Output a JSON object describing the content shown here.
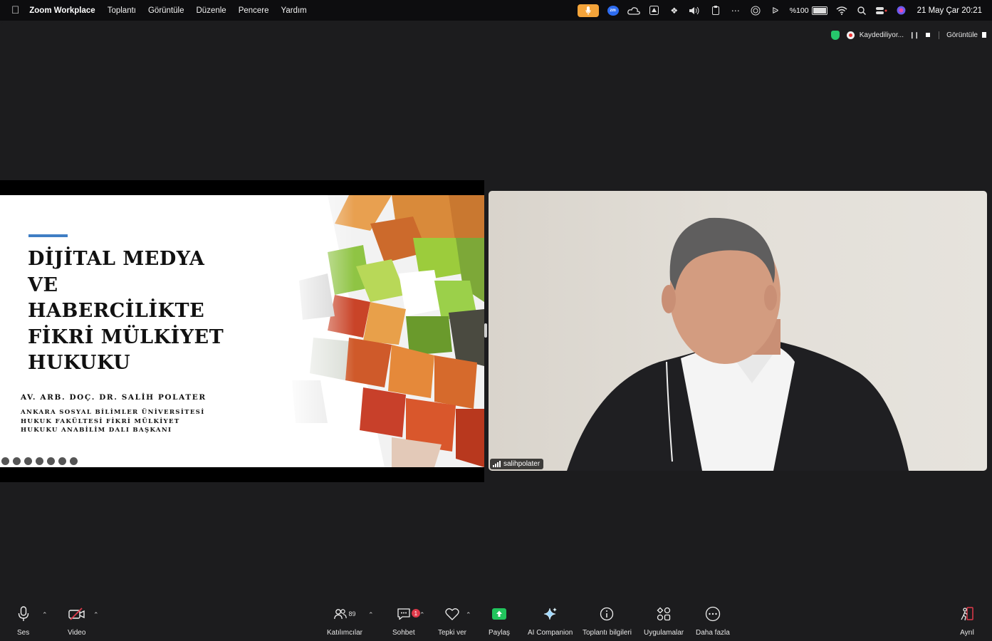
{
  "menubar": {
    "app_name": "Zoom Workplace",
    "menus": [
      "Toplantı",
      "Görüntüle",
      "Düzenle",
      "Pencere",
      "Yardım"
    ],
    "battery": "%100",
    "datetime": "21 May Çar  20:21"
  },
  "status": {
    "recording": "Kaydediliyor...",
    "view": "Görüntüle"
  },
  "slide": {
    "title_lines": [
      "DİJİTAL MEDYA",
      "VE",
      "HABERCİLİKTE",
      "FİKRİ MÜLKİYET",
      "HUKUKU"
    ],
    "author": "AV. ARB. DOÇ. DR. SALİH POLATER",
    "affiliation": "ANKARA SOSYAL BİLİMLER ÜNİVERSİTESİ\nHUKUK FAKÜLTESİ FİKRİ MÜLKİYET\nHUKUKU ANABİLİM DALI BAŞKANI"
  },
  "video": {
    "participant_name": "salihpolater"
  },
  "toolbar": {
    "audio": "Ses",
    "video": "Video",
    "participants": "Katılımcılar",
    "participants_count": "89",
    "chat": "Sohbet",
    "chat_badge": "1",
    "react": "Tepki ver",
    "share": "Paylaş",
    "ai": "AI Companion",
    "info": "Toplantı bilgileri",
    "apps": "Uygulamalar",
    "more": "Daha fazla",
    "leave": "Ayrıl"
  },
  "colors": {
    "share_green": "#21c55d",
    "record_red": "#e33333",
    "mic_pill": "#f4a43a",
    "slide_accent": "#3f7ec4"
  }
}
